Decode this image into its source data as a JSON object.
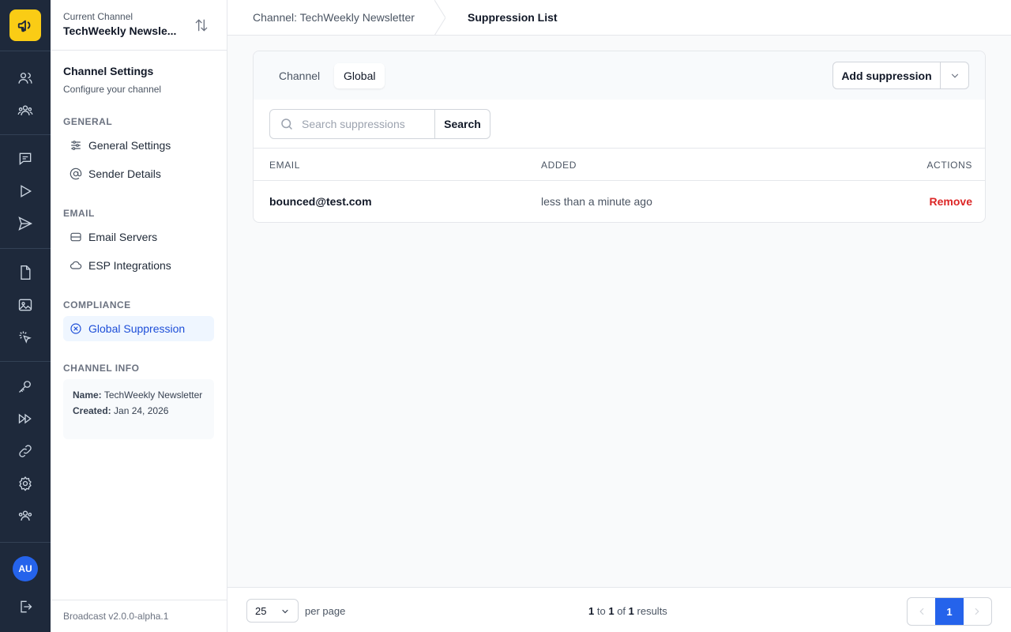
{
  "sidebar": {
    "current_channel_label": "Current Channel",
    "current_channel_name": "TechWeekly Newsle...",
    "section_title": "Channel Settings",
    "section_subtitle": "Configure your channel",
    "groups": [
      "GENERAL",
      "EMAIL",
      "COMPLIANCE",
      "CHANNEL INFO"
    ],
    "items": [
      {
        "label": "General Settings",
        "icon": "sliders-icon"
      },
      {
        "label": "Sender Details",
        "icon": "at-sign-icon"
      },
      {
        "label": "Email Servers",
        "icon": "server-icon"
      },
      {
        "label": "ESP Integrations",
        "icon": "cloud-icon"
      },
      {
        "label": "Global Suppression",
        "icon": "x-circle-icon",
        "active": true
      }
    ],
    "info": {
      "name_label": "Name:",
      "name_value": "TechWeekly Newsletter",
      "created_label": "Created:",
      "created_value": "Jan 24, 2026"
    },
    "version": "Broadcast v2.0.0-alpha.1"
  },
  "rail": {
    "avatar_initials": "AU",
    "icons": [
      "megaphone-icon",
      "users-icon",
      "team-icon",
      "message-icon",
      "play-icon",
      "send-icon",
      "file-icon",
      "image-icon",
      "click-icon",
      "key-icon",
      "fast-forward-icon",
      "link-icon",
      "gear-icon",
      "group-icon",
      "logout-icon"
    ]
  },
  "breadcrumb": {
    "parent": "Channel: TechWeekly Newsletter",
    "current": "Suppression List"
  },
  "tabs": [
    "Channel",
    "Global"
  ],
  "active_tab": "Global",
  "add_button_label": "Add suppression",
  "search": {
    "placeholder": "Search suppressions",
    "button_label": "Search"
  },
  "table": {
    "headers": [
      "EMAIL",
      "ADDED",
      "ACTIONS"
    ],
    "rows": [
      {
        "email": "bounced@test.com",
        "added": "less than a minute ago",
        "action": "Remove"
      }
    ]
  },
  "pagination": {
    "per_page_value": "25",
    "per_page_label": "per page",
    "from": "1",
    "to_word": "to",
    "to": "1",
    "of_word": "of",
    "total": "1",
    "results_word": "results",
    "current_page": "1"
  },
  "colors": {
    "rail_bg": "#1e293b",
    "logo_bg": "#facc15",
    "accent": "#2563eb",
    "danger": "#dc2626"
  }
}
